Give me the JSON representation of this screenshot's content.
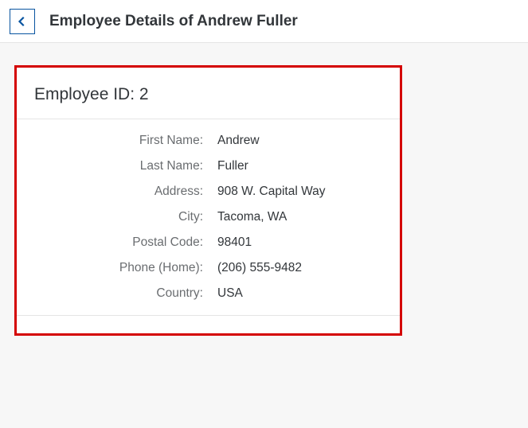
{
  "header": {
    "title": "Employee Details of Andrew Fuller"
  },
  "card": {
    "title": "Employee ID: 2"
  },
  "labels": {
    "firstName": "First Name:",
    "lastName": "Last Name:",
    "address": "Address:",
    "city": "City:",
    "postalCode": "Postal Code:",
    "phoneHome": "Phone (Home):",
    "country": "Country:"
  },
  "employee": {
    "firstName": "Andrew",
    "lastName": "Fuller",
    "address": "908 W. Capital Way",
    "city": "Tacoma, WA",
    "postalCode": "98401",
    "phoneHome": "(206) 555-9482",
    "country": "USA"
  }
}
